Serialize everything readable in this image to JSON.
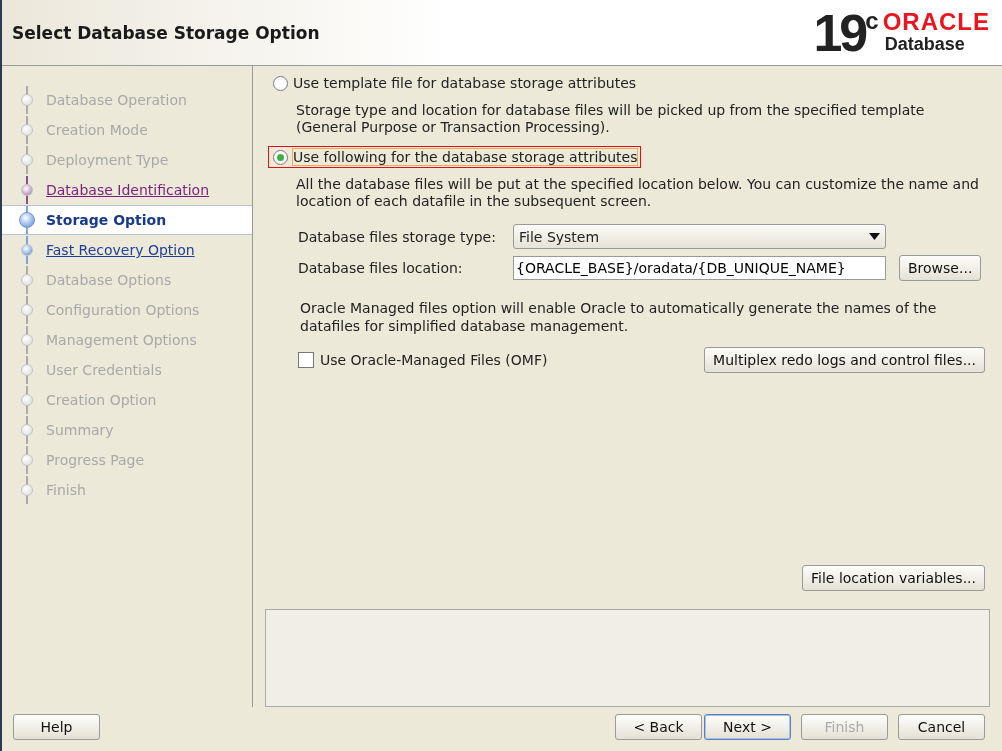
{
  "header": {
    "title": "Select Database Storage Option",
    "logo_version": "19",
    "logo_sup": "c",
    "logo_brand": "ORACLE",
    "logo_product": "Database"
  },
  "steps": [
    {
      "label": "Database Operation",
      "kind": "disabled",
      "selected": false
    },
    {
      "label": "Creation Mode",
      "kind": "disabled",
      "selected": false
    },
    {
      "label": "Deployment Type",
      "kind": "disabled",
      "selected": false
    },
    {
      "label": "Database Identification",
      "kind": "visited",
      "selected": false
    },
    {
      "label": "Storage Option",
      "kind": "current",
      "selected": true
    },
    {
      "label": "Fast Recovery Option",
      "kind": "link",
      "selected": false
    },
    {
      "label": "Database Options",
      "kind": "disabled",
      "selected": false
    },
    {
      "label": "Configuration Options",
      "kind": "disabled",
      "selected": false
    },
    {
      "label": "Management Options",
      "kind": "disabled",
      "selected": false
    },
    {
      "label": "User Credentials",
      "kind": "disabled",
      "selected": false
    },
    {
      "label": "Creation Option",
      "kind": "disabled",
      "selected": false
    },
    {
      "label": "Summary",
      "kind": "disabled",
      "selected": false
    },
    {
      "label": "Progress Page",
      "kind": "disabled",
      "selected": false
    },
    {
      "label": "Finish",
      "kind": "disabled",
      "selected": false
    }
  ],
  "options": [
    {
      "label": "Use template file for database storage attributes",
      "selected": false,
      "focused": false,
      "description": "Storage type and location for database files will be picked up from the specified template (General Purpose or Transaction Processing)."
    },
    {
      "label": "Use following for the database storage attributes",
      "selected": true,
      "focused": true,
      "description": "All the database files will be put at the specified location below. You can customize the name and location of each datafile in the subsequent screen."
    }
  ],
  "storage_type": {
    "label": "Database files storage type:",
    "value": "File System"
  },
  "location": {
    "label": "Database files location:",
    "value": "{ORACLE_BASE}/oradata/{DB_UNIQUE_NAME}",
    "button": "Browse..."
  },
  "omf_note": "Oracle Managed files option will enable Oracle to automatically generate the names of the datafiles for simplified database management.",
  "omf": {
    "label": "Use Oracle-Managed Files (OMF)",
    "checked": false
  },
  "multiplex_button": "Multiplex redo logs and control files...",
  "variables_button": "File location variables...",
  "footer": {
    "help": "Help",
    "buttons": [
      {
        "label": "< Back",
        "disabled": false,
        "default": false
      },
      {
        "label": "Next >",
        "disabled": false,
        "default": true
      },
      {
        "label": "Finish",
        "disabled": true,
        "default": false
      },
      {
        "label": "Cancel",
        "disabled": false,
        "default": false
      }
    ]
  }
}
